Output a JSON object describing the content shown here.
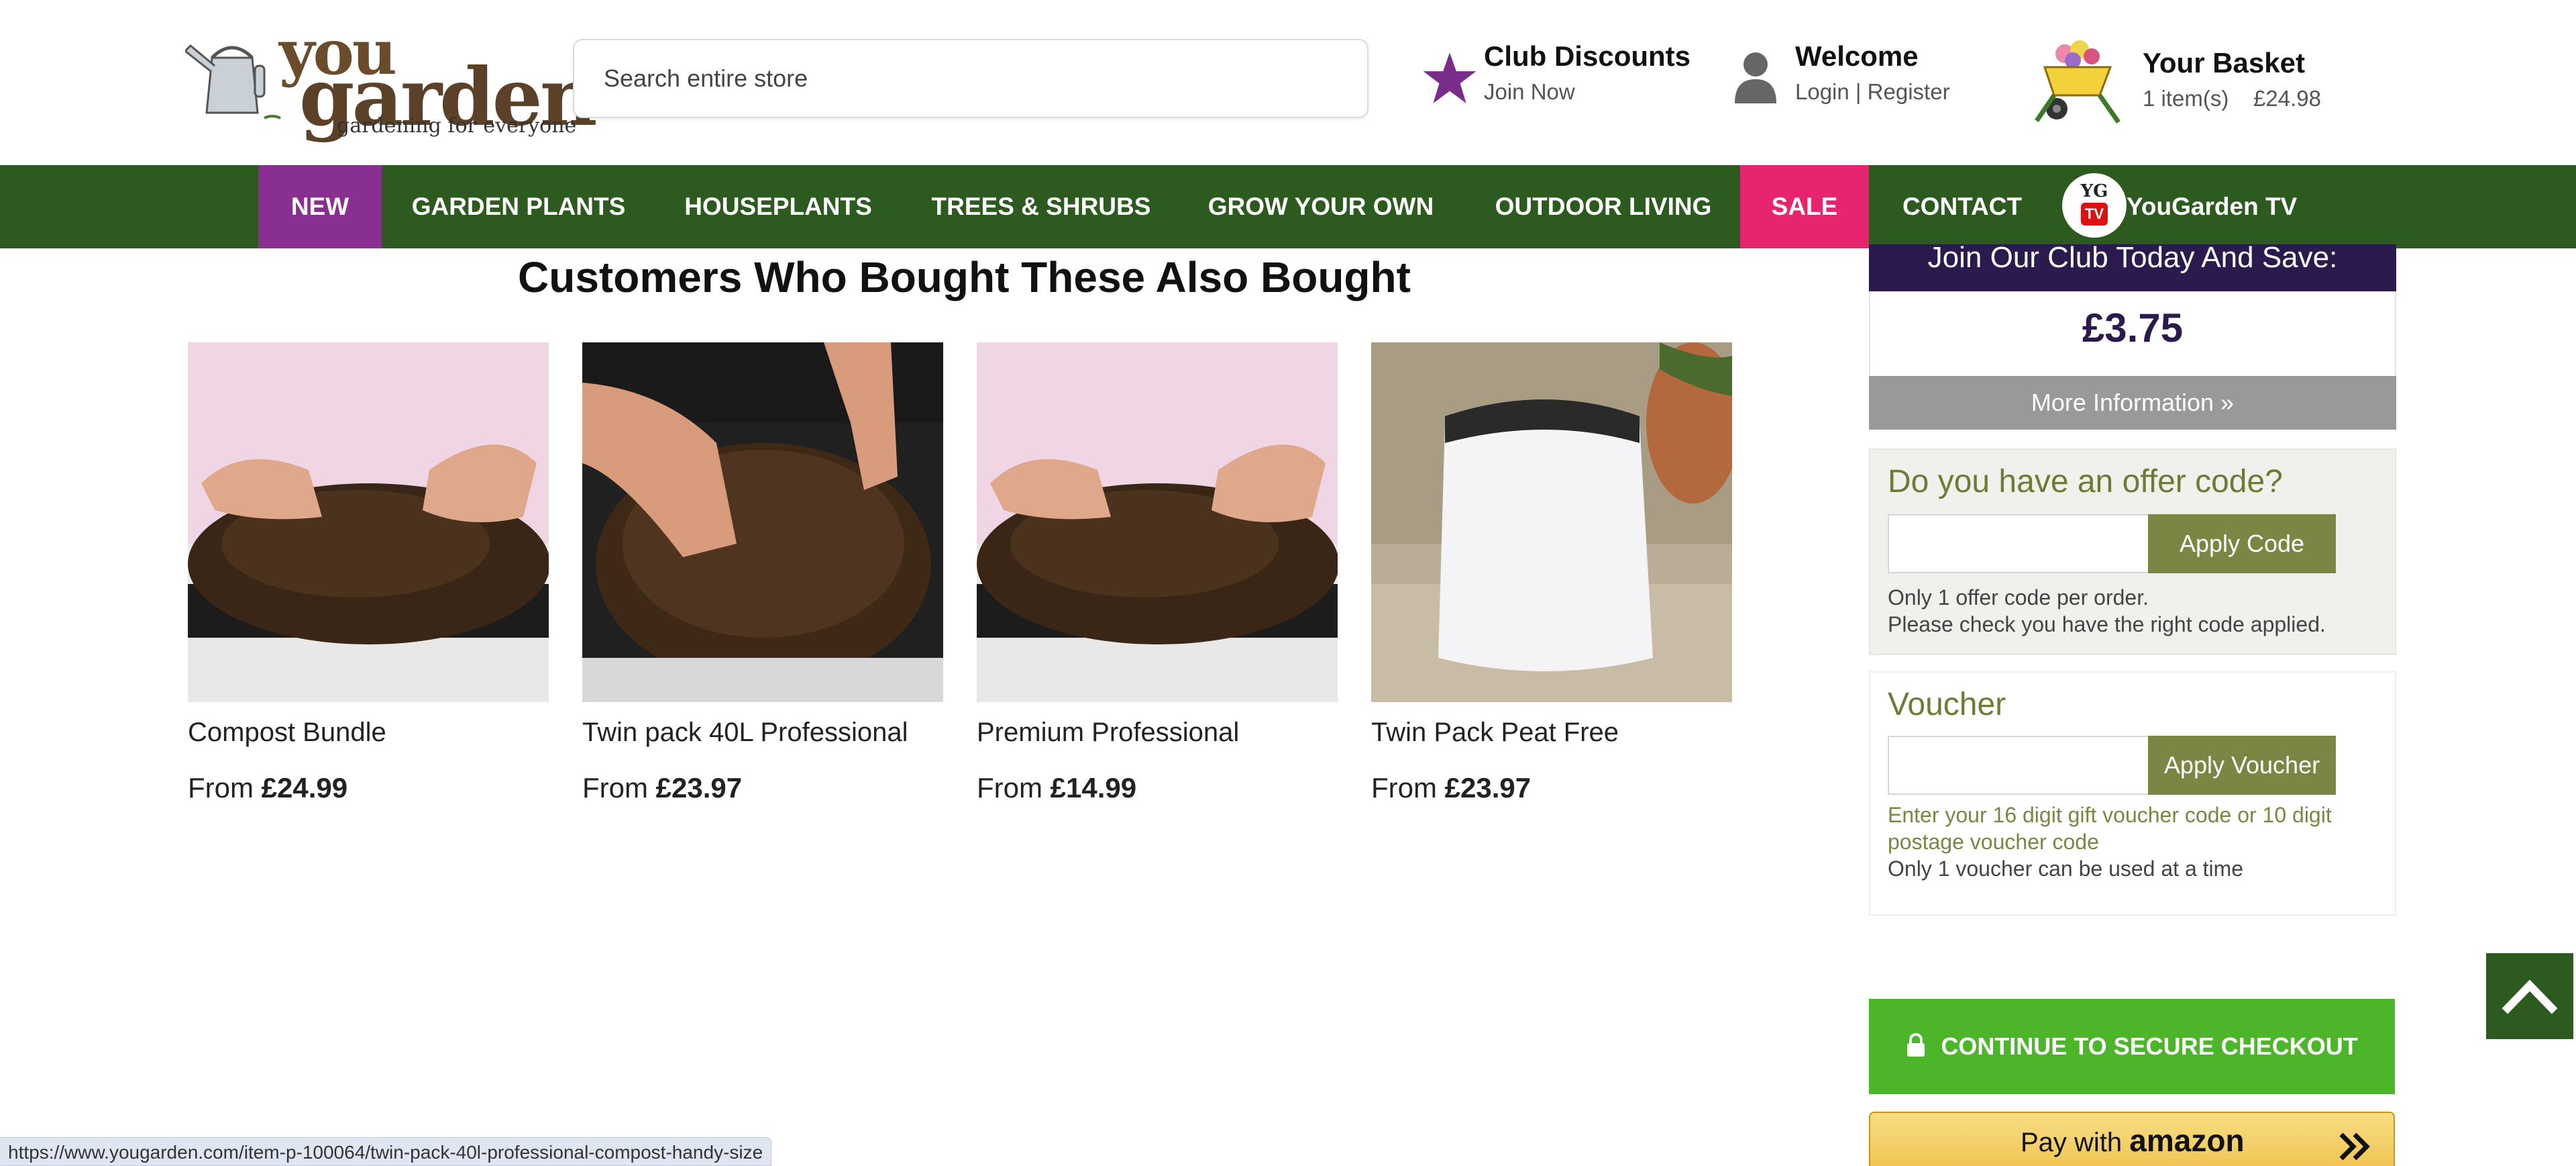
{
  "header": {
    "logo": {
      "word1": "you",
      "word2": "garden",
      "tagline": "gardening for everyone"
    },
    "search": {
      "placeholder": "Search entire store"
    },
    "club": {
      "title": "Club Discounts",
      "sub": "Join Now"
    },
    "account": {
      "title": "Welcome",
      "login": "Login",
      "separator": "|",
      "register": "Register"
    },
    "basket": {
      "title": "Your Basket",
      "items": "1 item(s)",
      "total": "£24.98"
    }
  },
  "nav": {
    "items": [
      {
        "label": "NEW"
      },
      {
        "label": "GARDEN PLANTS"
      },
      {
        "label": "HOUSEPLANTS"
      },
      {
        "label": "TREES & SHRUBS"
      },
      {
        "label": "GROW YOUR OWN"
      },
      {
        "label": "OUTDOOR LIVING"
      },
      {
        "label": "SALE"
      },
      {
        "label": "CONTACT"
      },
      {
        "label": "YouGarden TV"
      }
    ],
    "ygtv_badge": {
      "top": "YG",
      "bottom": "TV"
    }
  },
  "main": {
    "section_title": "Customers Who Bought These Also Bought",
    "products": [
      {
        "name": "Compost Bundle",
        "price_prefix": "From",
        "price": "£24.99"
      },
      {
        "name": "Twin pack 40L Professional",
        "price_prefix": "From",
        "price": "£23.97"
      },
      {
        "name": "Premium Professional",
        "price_prefix": "From",
        "price": "£14.99"
      },
      {
        "name": "Twin Pack Peat Free",
        "price_prefix": "From",
        "price": "£23.97"
      }
    ]
  },
  "sidebar": {
    "club_banner": "Join Our Club Today And Save:",
    "club_saving": "£3.75",
    "more_info": "More Information »",
    "offer": {
      "title": "Do you have an offer code?",
      "input_value": "",
      "button": "Apply Code",
      "note1": "Only 1 offer code per order.",
      "note2": "Please check you have the right code applied."
    },
    "voucher": {
      "title": "Voucher",
      "input_value": "",
      "button": "Apply Voucher",
      "note1": "Enter your 16 digit gift voucher code or 10 digit",
      "note2": "postage voucher code",
      "note3": "Only 1 voucher can be used at a time"
    },
    "checkout": "CONTINUE TO SECURE CHECKOUT",
    "amazon": {
      "prefix": "Pay with",
      "brand": "amazon"
    }
  },
  "status_bar": {
    "url": "https://www.yougarden.com/item-p-100064/twin-pack-40l-professional-compost-handy-size"
  },
  "colors": {
    "nav_green": "#2d5a1f",
    "new_purple": "#8a2f92",
    "sale_pink": "#e8246f",
    "club_purple": "#2a1a4e",
    "olive": "#7a8744",
    "checkout_green": "#4db52a"
  },
  "icons": [
    "watering-can-icon",
    "star-icon",
    "user-icon",
    "wheelbarrow-icon",
    "lock-icon",
    "chevron-up-icon",
    "double-chevron-right-icon"
  ]
}
